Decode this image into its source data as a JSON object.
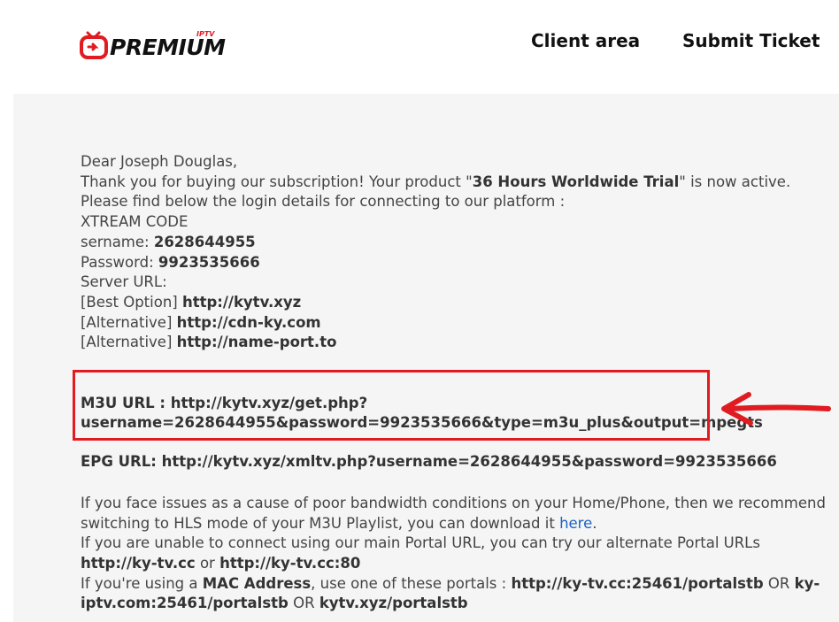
{
  "header": {
    "logo_text": "PREMIUM",
    "logo_badge": "IPTV",
    "nav": [
      {
        "label": "Client area"
      },
      {
        "label": "Submit Ticket"
      }
    ]
  },
  "email": {
    "greeting": "Dear Joseph Douglas,",
    "thanks_pre": "Thank you for buying our subscription! Your product \"",
    "product": "36 Hours Worldwide Trial",
    "thanks_post": "\" is now active.",
    "find_below": "Please find below the login details for connecting to our platform :",
    "xtream_label": "XTREAM CODE",
    "username_label": "sername: ",
    "username": "2628644955",
    "password_label": "Password: ",
    "password": "9923535666",
    "server_label": "Server URL:",
    "servers": [
      {
        "tag": "[Best Option] ",
        "url": "http://kytv.xyz"
      },
      {
        "tag": "[Alternative] ",
        "url": "http://cdn-ky.com"
      },
      {
        "tag": "[Alternative] ",
        "url": "http://name-port.to"
      }
    ],
    "m3u_line1": "M3U URL : http://kytv.xyz/get.php?",
    "m3u_line2": "username=2628644955&password=9923535666&type=m3u_plus&output=mpegts",
    "epg_label": "EPG URL",
    "epg_value": ": http://kytv.xyz/xmltv.php?username=2628644955&password=9923535666",
    "hls_text": "If you face issues as a cause of poor bandwidth conditions on your Home/Phone, then we recommend switching to HLS mode of your M3U Playlist, you can download it ",
    "hls_link": "here",
    "hls_end": ".",
    "alt_portal_pre": "If you are unable to connect using our main Portal URL, you can try our alternate Portal URLs ",
    "alt_portal_1": "http://ky-tv.cc",
    "alt_portal_or": " or ",
    "alt_portal_2": "http://ky-tv.cc:80",
    "mac_pre": "If you're using a ",
    "mac_label": "MAC Address",
    "mac_mid": ", use one of these portals : ",
    "mac_portal_1": "http://ky-tv.cc:25461/portalstb",
    "mac_or1": " OR ",
    "mac_portal_2": "ky-iptv.com:25461/portalstb",
    "mac_or2": " OR ",
    "mac_portal_3": "kytv.xyz/portalstb"
  },
  "colors": {
    "accent_red": "#e01b22",
    "link_blue": "#1a62c4",
    "panel_bg": "#f5f5f5"
  }
}
